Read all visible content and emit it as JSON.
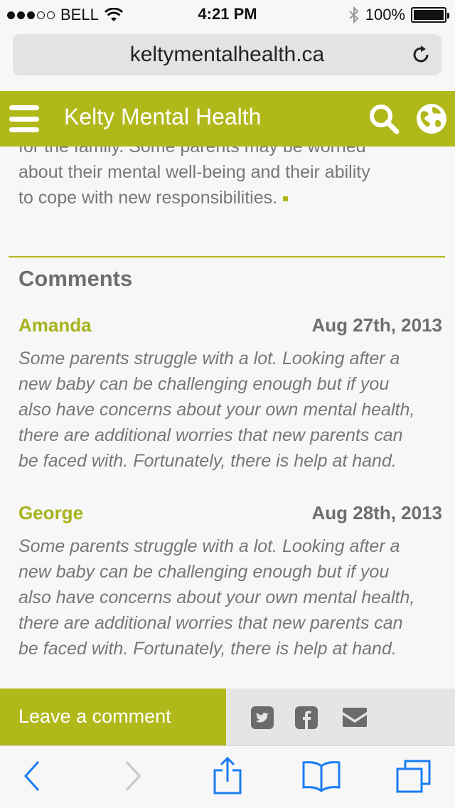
{
  "status_bar": {
    "carrier": "BELL",
    "time": "4:21 PM",
    "battery": "100%",
    "signal_strength": 3,
    "signal_total": 5
  },
  "browser": {
    "url": "keltymentalhealth.ca"
  },
  "header": {
    "title": "Kelty Mental Health",
    "brand_color": "#b1b81a"
  },
  "article": {
    "lines": [
      "for the family.  Some parents may be worried",
      "about their mental well-being and their ability",
      "to cope with new responsibilities."
    ]
  },
  "comments": {
    "heading": "Comments",
    "items": [
      {
        "author": "Amanda",
        "date": "Aug 27th, 2013",
        "lines": [
          "Some parents struggle with a lot. Looking after a",
          "new baby can be challenging enough but if you",
          "also have concerns about your own mental health,",
          "there are additional worries that new parents can",
          "be faced with. Fortunately, there is help at hand."
        ]
      },
      {
        "author": "George",
        "date": "Aug 28th, 2013",
        "lines": [
          "Some parents struggle with a lot. Looking after a",
          "new baby can be challenging enough but if you",
          "also have concerns about your own mental health,",
          "there are additional worries that new parents can",
          "be faced with. Fortunately, there is help at hand."
        ]
      }
    ]
  },
  "action_bar": {
    "leave_comment": "Leave a comment",
    "share_icons": [
      "twitter-icon",
      "facebook-icon",
      "email-icon"
    ]
  },
  "toolbar": {
    "icons": [
      "back-icon",
      "forward-icon",
      "share-icon",
      "bookmarks-icon",
      "tabs-icon"
    ]
  }
}
